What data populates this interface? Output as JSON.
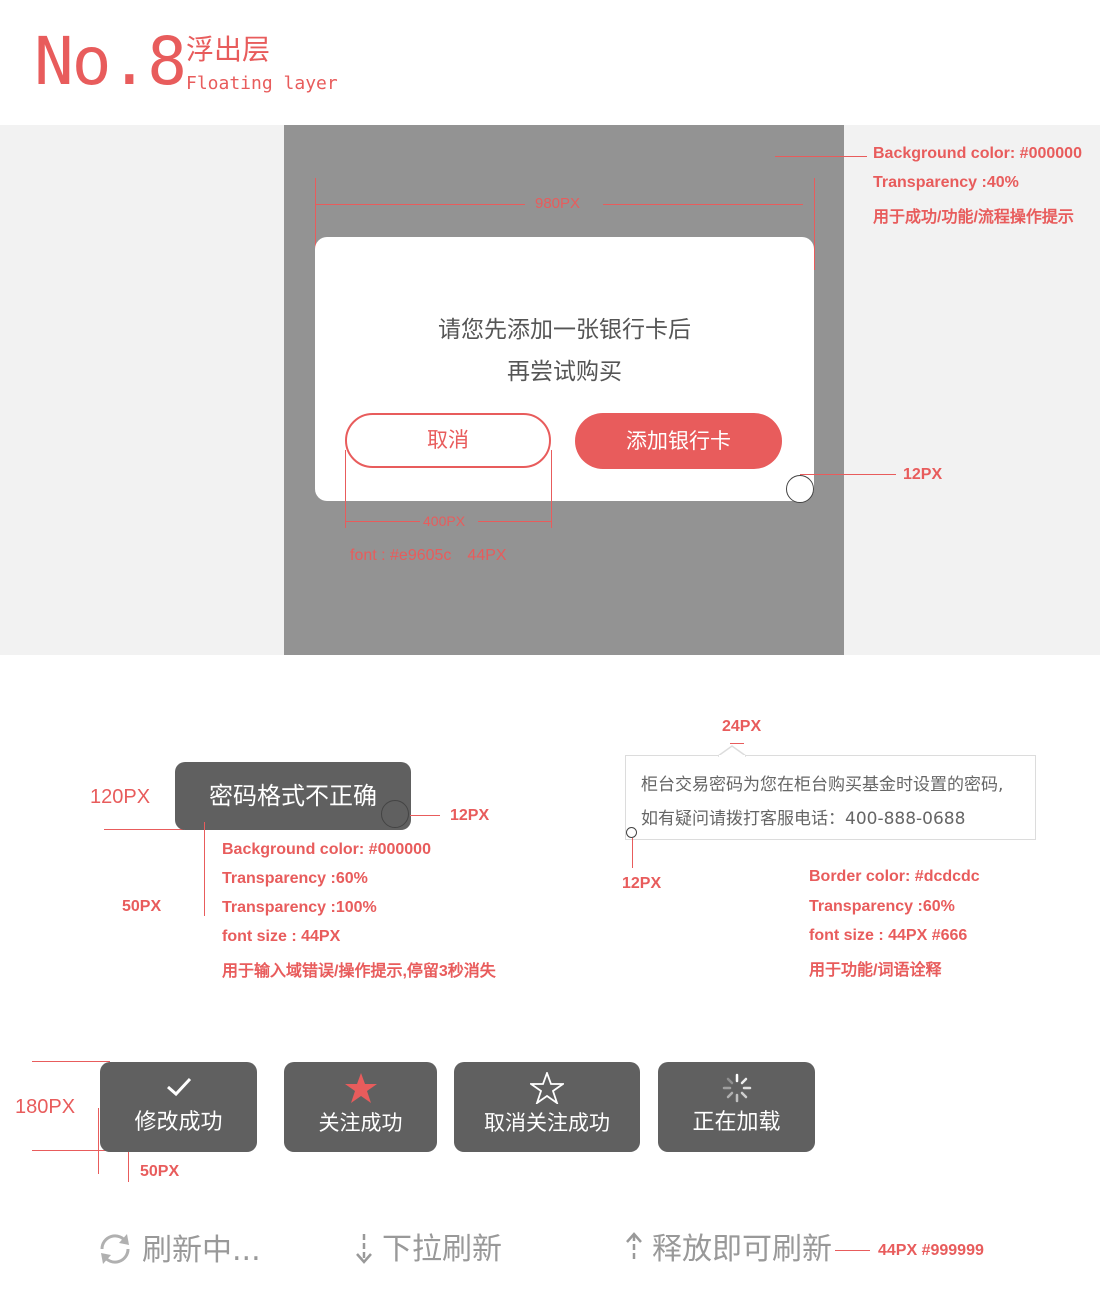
{
  "header": {
    "number": "No.8",
    "title_cn": "浮出层",
    "title_en": "Floating layer"
  },
  "overlay_section": {
    "annotations": {
      "bg_color": "Background color: #000000",
      "transparency": "Transparency :40%",
      "usage": "用于成功/功能/流程操作提示",
      "width": "980PX",
      "radius": "12PX",
      "button_width": "400PX",
      "font": "font : #e9605c　44PX"
    },
    "dialog": {
      "line1": "请您先添加一张银行卡后",
      "line2": "再尝试购买",
      "cancel": "取消",
      "confirm": "添加银行卡"
    }
  },
  "toast_section": {
    "toast_text": "密码格式不正确",
    "height": "120PX",
    "radius": "12PX",
    "padding": "50PX",
    "annotations": [
      "Background color: #000000",
      "Transparency :60%",
      "Transparency :100%",
      "font size : 44PX",
      "用于输入域错误/操作提示,停留3秒消失"
    ]
  },
  "tip_section": {
    "arrow_width": "24PX",
    "radius": "12PX",
    "line1": "柜台交易密码为您在柜台购买基金时设置的密码,",
    "line2": "如有疑问请拨打客服电话：400-888-0688",
    "annotations": [
      "Border color: #dcdcdc",
      "Transparency :60%",
      "font size : 44PX  #666",
      "用于功能/词语诠释"
    ]
  },
  "status_tiles": {
    "height": "180PX",
    "padding": "50PX",
    "items": [
      {
        "icon": "check-icon",
        "label": "修改成功"
      },
      {
        "icon": "star-filled-icon",
        "label": "关注成功"
      },
      {
        "icon": "star-outline-icon",
        "label": "取消关注成功"
      },
      {
        "icon": "spinner-icon",
        "label": "正在加载"
      }
    ]
  },
  "refresh_section": {
    "items": [
      {
        "icon": "refresh-icon",
        "label": "刷新中..."
      },
      {
        "icon": "arrow-down-icon",
        "label": "下拉刷新"
      },
      {
        "icon": "arrow-up-icon",
        "label": "释放即可刷新"
      }
    ],
    "annotation": "44PX  #999999"
  },
  "colors": {
    "accent": "#e85c5c",
    "toast_bg": "#606060",
    "overlay": "#939393",
    "light_bg": "#f2f2f2"
  }
}
